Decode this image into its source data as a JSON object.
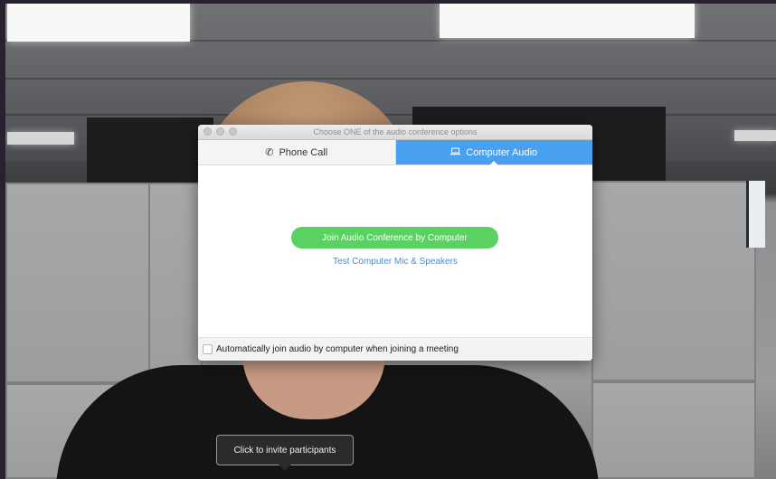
{
  "dialog": {
    "title": "Choose ONE of the audio conference options",
    "tabs": [
      {
        "label": "Phone Call",
        "icon": "phone-icon",
        "active": false
      },
      {
        "label": "Computer Audio",
        "icon": "laptop-icon",
        "active": true
      }
    ],
    "join_button": "Join Audio Conference by Computer",
    "test_link": "Test Computer Mic & Speakers",
    "auto_join_label": "Automatically join audio by computer when joining a meeting",
    "auto_join_checked": false
  },
  "tooltip": {
    "text": "Click to invite participants"
  },
  "colors": {
    "active_tab": "#4aa0f0",
    "join_button": "#5bd063",
    "link": "#3d8fe0"
  }
}
